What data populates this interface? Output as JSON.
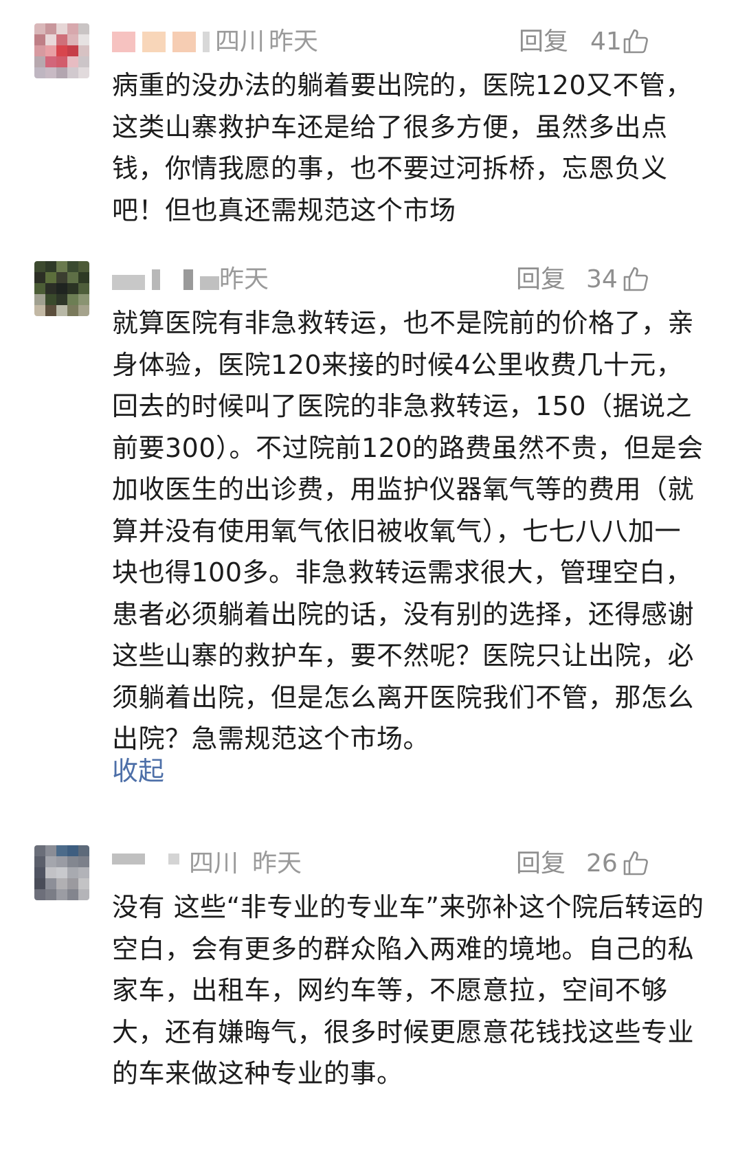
{
  "comments": [
    {
      "location": "四川",
      "time": "昨天",
      "reply_label": "回复",
      "likes": "41",
      "text": "病重的没办法的躺着要出院的，医院120又不管，这类山寨救护车还是给了很多方便，虽然多出点钱，你情我愿的事，也不要过河拆桥，忘恩负义吧！但也真还需规范这个市场"
    },
    {
      "location": "",
      "time": "昨天",
      "reply_label": "回复",
      "likes": "34",
      "text": "就算医院有非急救转运，也不是院前的价格了，亲身体验，医院120来接的时候4公里收费几十元，回去的时候叫了医院的非急救转运，150（据说之前要300）。不过院前120的路费虽然不贵，但是会加收医生的出诊费，用监护仪器氧气等的费用（就算并没有使用氧气依旧被收氧气），七七八八加一块也得100多。非急救转运需求很大，管理空白，患者必须躺着出院的话，没有别的选择，还得感谢这些山寨的救护车，要不然呢？医院只让出院，必须躺着出院，但是怎么离开医院我们不管，那怎么出院？急需规范这个市场。",
      "collapse_label": "收起"
    },
    {
      "location": "四川",
      "time": "昨天",
      "reply_label": "回复",
      "likes": "26",
      "text": "没有 这些“非专业的专业车”来弥补这个院后转运的空白，会有更多的群众陷入两难的境地。自己的私家车，出租车，网约车等，不愿意拉，空间不够大，还有嫌晦气，很多时候更愿意花钱找这些专业的车来做这种专业的事。"
    }
  ],
  "colors": {
    "meta": "#9a9a9a",
    "link": "#4d6fa8",
    "text": "#1c1c1c"
  },
  "icons": {
    "like": "thumbs-up-icon",
    "avatar": "avatar"
  }
}
